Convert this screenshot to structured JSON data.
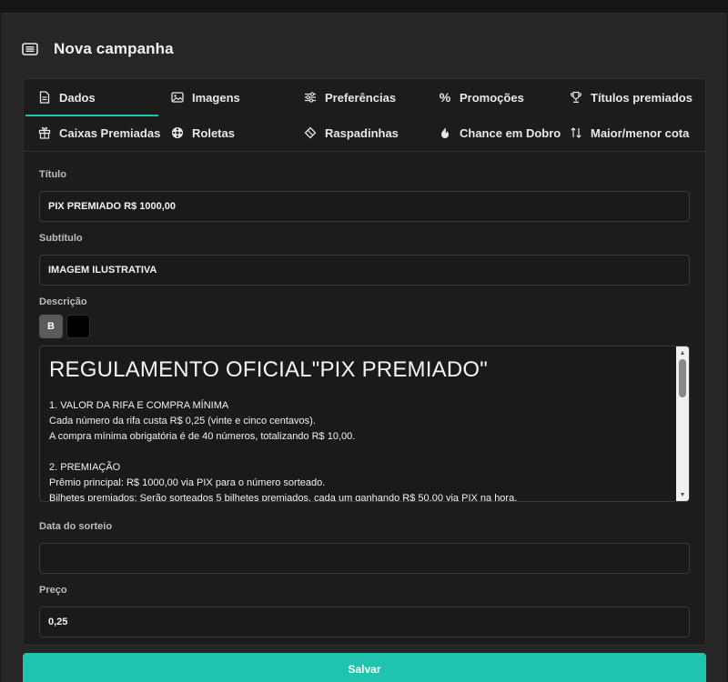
{
  "page": {
    "title": "Nova campanha",
    "accent_color": "#1fc3ae"
  },
  "tabs": [
    {
      "label": "Dados",
      "icon": "document-icon",
      "active": true
    },
    {
      "label": "Imagens",
      "icon": "image-icon"
    },
    {
      "label": "Preferências",
      "icon": "sliders-icon"
    },
    {
      "label": "Promoções",
      "icon": "percent-icon"
    },
    {
      "label": "Títulos premiados",
      "icon": "trophy-icon"
    },
    {
      "label": "Caixas Premiadas",
      "icon": "gift-icon"
    },
    {
      "label": "Roletas",
      "icon": "wheel-icon"
    },
    {
      "label": "Raspadinhas",
      "icon": "eraser-icon"
    },
    {
      "label": "Chance em Dobro",
      "icon": "fire-icon"
    },
    {
      "label": "Maior/menor cota",
      "icon": "sort-arrows-icon"
    }
  ],
  "form": {
    "titulo_label": "Título",
    "titulo_value": "PIX PREMIADO R$ 1000,00",
    "subtitulo_label": "Subtítulo",
    "subtitulo_value": "IMAGEM ILUSTRATIVA",
    "descricao_label": "Descrição",
    "bold_button": "B",
    "data_label": "Data do sorteio",
    "data_value": "",
    "preco_label": "Preço",
    "preco_value": "0,25"
  },
  "editor": {
    "heading": "REGULAMENTO OFICIAL\"PIX PREMIADO\"",
    "lines": [
      "1. VALOR DA RIFA E COMPRA MÍNIMA",
      "Cada número da rifa custa R$ 0,25 (vinte e cinco centavos).",
      "A compra mínima obrigatória é de 40 números, totalizando R$ 10,00.",
      "",
      "2. PREMIAÇÃO",
      "Prêmio principal: R$ 1000,00 via PIX para o número sorteado.",
      "Bilhetes premiados: Serão sorteados 5 bilhetes premiados, cada um ganhando R$ 50,00 via PIX na hora."
    ]
  },
  "actions": {
    "save_label": "Salvar"
  }
}
